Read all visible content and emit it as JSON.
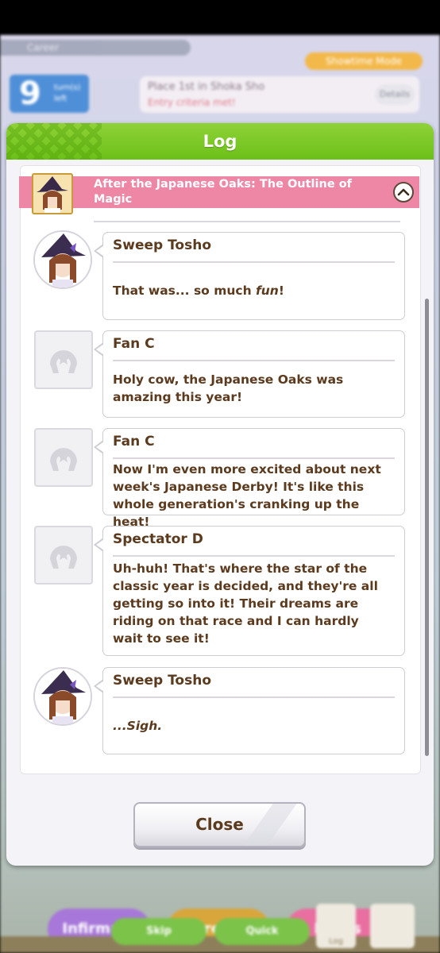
{
  "background": {
    "career_label": "Career",
    "turn_number": "9",
    "turn_sub_label": "turn(s) left",
    "goal_title": "Place 1st in Shoka Sho",
    "goal_subtitle": "Entry criteria met!",
    "details_label": "Details",
    "showtime_label": "Showtime Mode",
    "buttons": [
      "Infirmary",
      "Recreation",
      "Races"
    ],
    "skip_label": "Skip",
    "quick_label": "Quick",
    "log_label": "Log"
  },
  "log": {
    "title": "Log",
    "event_title": "After the Japanese Oaks: The Outline of Magic",
    "entries": [
      {
        "speaker": "Sweep Tosho",
        "avatar": "sweep-tosho-portrait",
        "text_parts": [
          "That was... so much ",
          "fun",
          "!"
        ]
      },
      {
        "speaker": "Fan C",
        "avatar": "horseshoe-placeholder-icon",
        "text": "Holy cow, the Japanese Oaks was amazing this year!"
      },
      {
        "speaker": "Fan C",
        "avatar": "horseshoe-placeholder-icon",
        "text": "Now I'm even more excited about next week's Japanese Derby! It's like this whole generation's cranking up the heat!"
      },
      {
        "speaker": "Spectator D",
        "avatar": "horseshoe-placeholder-icon",
        "text": "Uh-huh! That's where the star of the classic year is decided, and they're all getting so into it! Their dreams are riding on that race and I can hardly wait to see it!"
      },
      {
        "speaker": "Sweep Tosho",
        "avatar": "sweep-tosho-portrait",
        "text": "...Sigh."
      }
    ],
    "close_label": "Close"
  },
  "colors": {
    "header_green": "#7cc928",
    "event_pink": "#ee87a6",
    "text_brown": "#5b3a1e"
  }
}
